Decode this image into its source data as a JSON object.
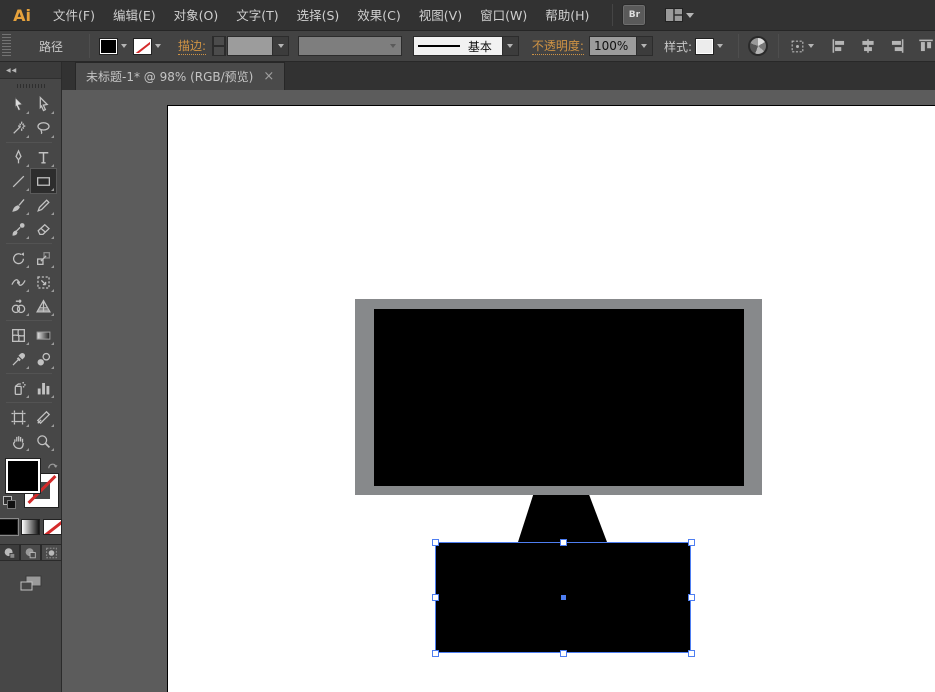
{
  "menubar": {
    "logo": "Ai",
    "items": [
      "文件(F)",
      "编辑(E)",
      "对象(O)",
      "文字(T)",
      "选择(S)",
      "效果(C)",
      "视图(V)",
      "窗口(W)",
      "帮助(H)"
    ],
    "bridge_button_label": "Br",
    "workspace_switcher_icon": "workspace-layout-icon"
  },
  "control_bar": {
    "selection_type_label": "路径",
    "fill_swatch": "black",
    "stroke_swatch": "none",
    "stroke_link_label": "描边:",
    "stroke_weight_value": "",
    "variable_width_profile_value": "",
    "brush_definition_value": "基本",
    "opacity_link_label": "不透明度:",
    "opacity_value": "100%",
    "style_label": "样式:",
    "icons": [
      "recolor-artwork-icon",
      "transform-icon",
      "align-left-icon",
      "align-horizontal-center-icon",
      "align-right-icon",
      "align-top-icon"
    ]
  },
  "document_tab": {
    "title": "未标题-1* @ 98% (RGB/预览)",
    "file_name": "未标题-1*",
    "zoom_percent": "98%",
    "color_mode": "RGB/预览",
    "close_glyph": "×"
  },
  "toolbar": {
    "collapse_glyph": "◀◀",
    "selected_tool": "rectangle-tool",
    "tools": [
      "selection-tool",
      "direct-selection-tool",
      "magic-wand-tool",
      "lasso-tool",
      "pen-tool",
      "type-tool",
      "line-segment-tool",
      "rectangle-tool",
      "paintbrush-tool",
      "pencil-tool",
      "blob-brush-tool",
      "eraser-tool",
      "rotate-tool",
      "scale-tool",
      "width-tool",
      "free-transform-tool",
      "shape-builder-tool",
      "perspective-grid-tool",
      "mesh-tool",
      "gradient-tool",
      "eyedropper-tool",
      "blend-tool",
      "symbol-sprayer-tool",
      "column-graph-tool",
      "artboard-tool",
      "slice-tool",
      "hand-tool",
      "zoom-tool"
    ],
    "separators_after_rows": [
      1,
      5,
      8,
      10,
      11
    ],
    "fill_color": "#000000",
    "stroke_color": "none"
  },
  "canvas": {
    "shapes": {
      "monitor_frame_color": "#87898b",
      "monitor_screen_color": "#000000",
      "stand_color": "#000000",
      "base_color": "#000000"
    }
  },
  "colors": {
    "accent_orange": "#cf9344",
    "selection_blue": "#4e7ef1",
    "pasteboard_gray": "#5c5c5c",
    "artboard_white": "#ffffff",
    "ui_dark": "#323232",
    "ui_mid": "#434343",
    "toolbar_bg": "#474747"
  }
}
